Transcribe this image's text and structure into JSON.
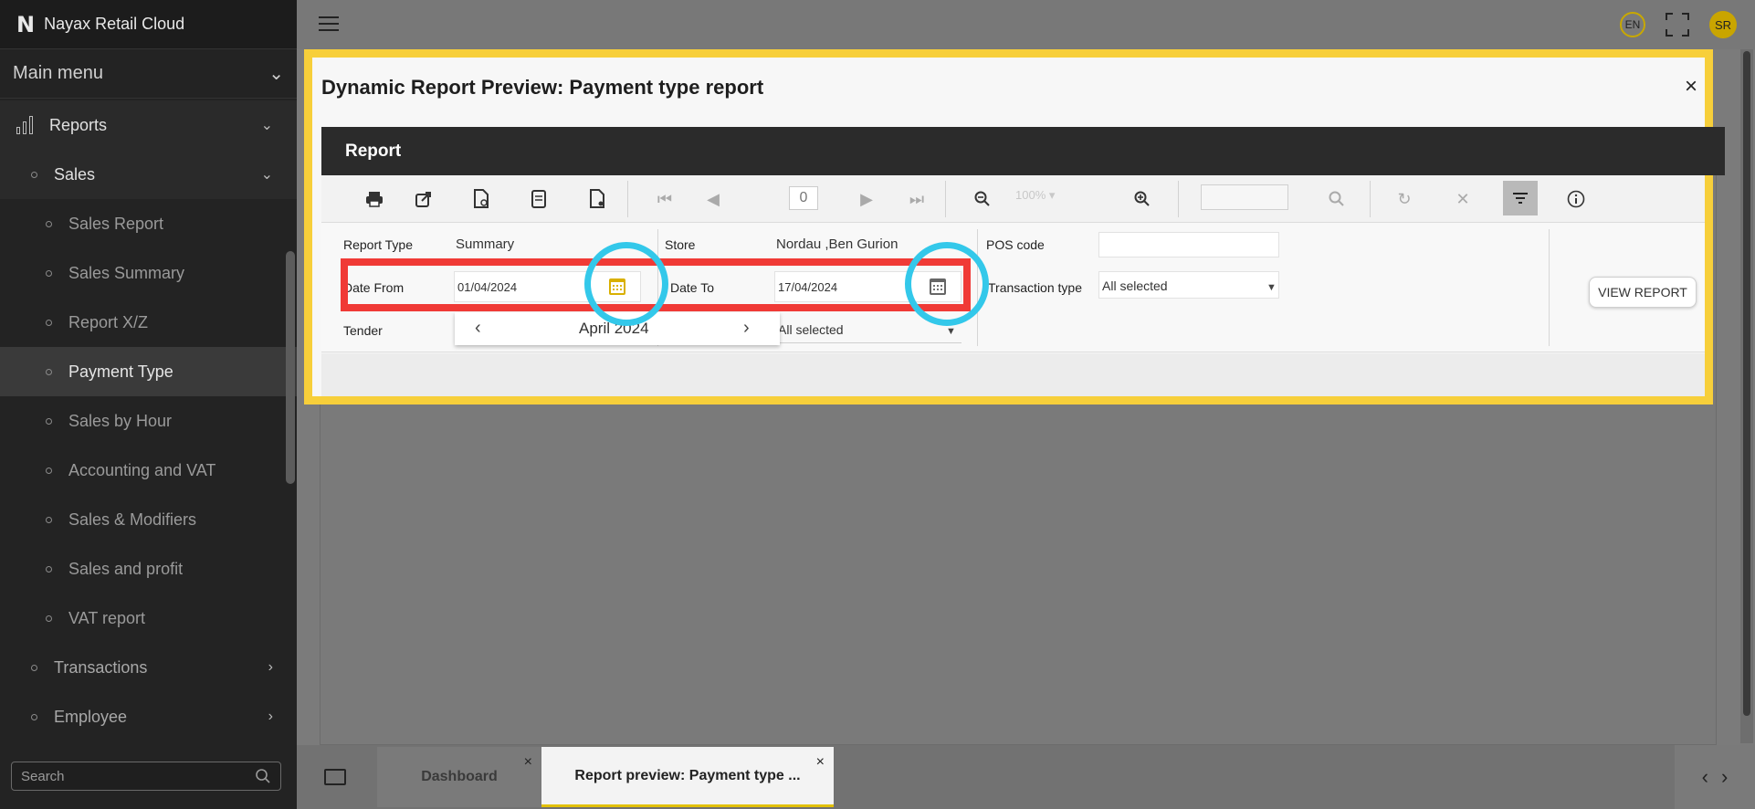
{
  "app": {
    "brand": "Nayax Retail Cloud",
    "logo_letter": "N"
  },
  "sidebar": {
    "main_menu": "Main menu",
    "reports": "Reports",
    "sales": "Sales",
    "sub_items": [
      "Sales Report",
      "Sales Summary",
      "Report X/Z",
      "Payment Type",
      "Sales by Hour",
      "Accounting and VAT",
      "Sales & Modifiers",
      "Sales and profit",
      "VAT report"
    ],
    "active_item": "Payment Type",
    "groups": [
      "Transactions",
      "Employee"
    ],
    "search_placeholder": "Search"
  },
  "topbar": {
    "lang": "EN",
    "user_initials": "SR"
  },
  "modal": {
    "title": "Dynamic Report Preview: Payment type report",
    "close": "×",
    "report_header": "Report",
    "page_number": "0",
    "zoom": "100%",
    "params": {
      "report_type_label": "Report Type",
      "report_type_value": "Summary",
      "store_label": "Store",
      "store_value": "Nordau ,Ben Gurion",
      "pos_code_label": "POS code",
      "date_from_label": "Date From",
      "date_from_value": "01/04/2024",
      "date_to_label": "Date To",
      "date_to_value": "17/04/2024",
      "transaction_type_label": "Transaction type",
      "transaction_type_value": "All selected",
      "tender_label": "Tender",
      "tender_value": "All selected",
      "view_report": "VIEW REPORT"
    },
    "datepicker": {
      "month": "April 2024"
    }
  },
  "tabs": [
    {
      "label": "Dashboard",
      "close": "×"
    },
    {
      "label": "Report preview: Payment type ...",
      "close": "×"
    }
  ],
  "colors": {
    "highlight_yellow": "#f7cf3a",
    "highlight_red": "#f03a36",
    "highlight_cyan": "#33c8ea",
    "accent": "#c9a500"
  }
}
